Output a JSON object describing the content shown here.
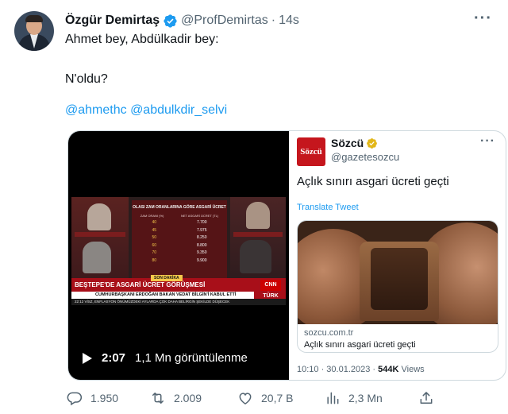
{
  "author": {
    "name": "Özgür Demirtaş",
    "handle": "@ProfDemirtas",
    "separator": "·",
    "time": "14s",
    "more_label": "···"
  },
  "tweet": {
    "line1": "Ahmet bey, Abdülkadir bey:",
    "line2": "N'oldu?",
    "mention1": "@ahmethc",
    "mention2": "@abdulkdir_selvi"
  },
  "video": {
    "duration": "2:07",
    "views": "1,1 Mn görüntülenme",
    "overlay": {
      "table_title": "OLASI ZAM ORANLARINA GÖRE ASGARİ ÜCRET",
      "col1": "ZAM ORANI (%)",
      "col2": "NET ASGARİ ÜCRET (TL)",
      "rows": [
        {
          "rate": "40",
          "wage": "7.700"
        },
        {
          "rate": "45",
          "wage": "7.975"
        },
        {
          "rate": "50",
          "wage": "8.250"
        },
        {
          "rate": "60",
          "wage": "8.800"
        },
        {
          "rate": "70",
          "wage": "9.350"
        },
        {
          "rate": "80",
          "wage": "9.900"
        }
      ],
      "tag": "SON DAKİKA",
      "headline": "BEŞTEPE'DE ASGARİ ÜCRET GÖRÜŞMESİ",
      "subline": "CUMHURBAŞKANI ERDOĞAN BAKAN VEDAT BİLGİN'İ KABUL ETTİ",
      "ticker": "22:12  VİSZ, ENFLASYON ÖNÜMÜZDEKİ AYLARDA ÇOK DAHA BELİRGİN ŞEKİLDE DÜŞECEK",
      "channel": "CNN TÜRK"
    }
  },
  "quote": {
    "logo_text": "Sözcü",
    "name": "Sözcü",
    "handle": "@gazetesozcu",
    "more_label": "···",
    "text": "Açlık sınırı asgari ücreti geçti",
    "translate": "Translate Tweet",
    "card": {
      "domain": "sozcu.com.tr",
      "title": "Açlık sınırı asgari ücreti geçti"
    },
    "meta_time": "10:10 · 30.01.2023 · ",
    "meta_views": "544K",
    "meta_views_label": " Views"
  },
  "actions": {
    "replies": "1.950",
    "retweets": "2.009",
    "likes": "20,7 B",
    "views": "2,3 Mn"
  },
  "colors": {
    "accent": "#1d9bf0",
    "secondary_text": "#536471",
    "sozcu_red": "#c5161d"
  }
}
